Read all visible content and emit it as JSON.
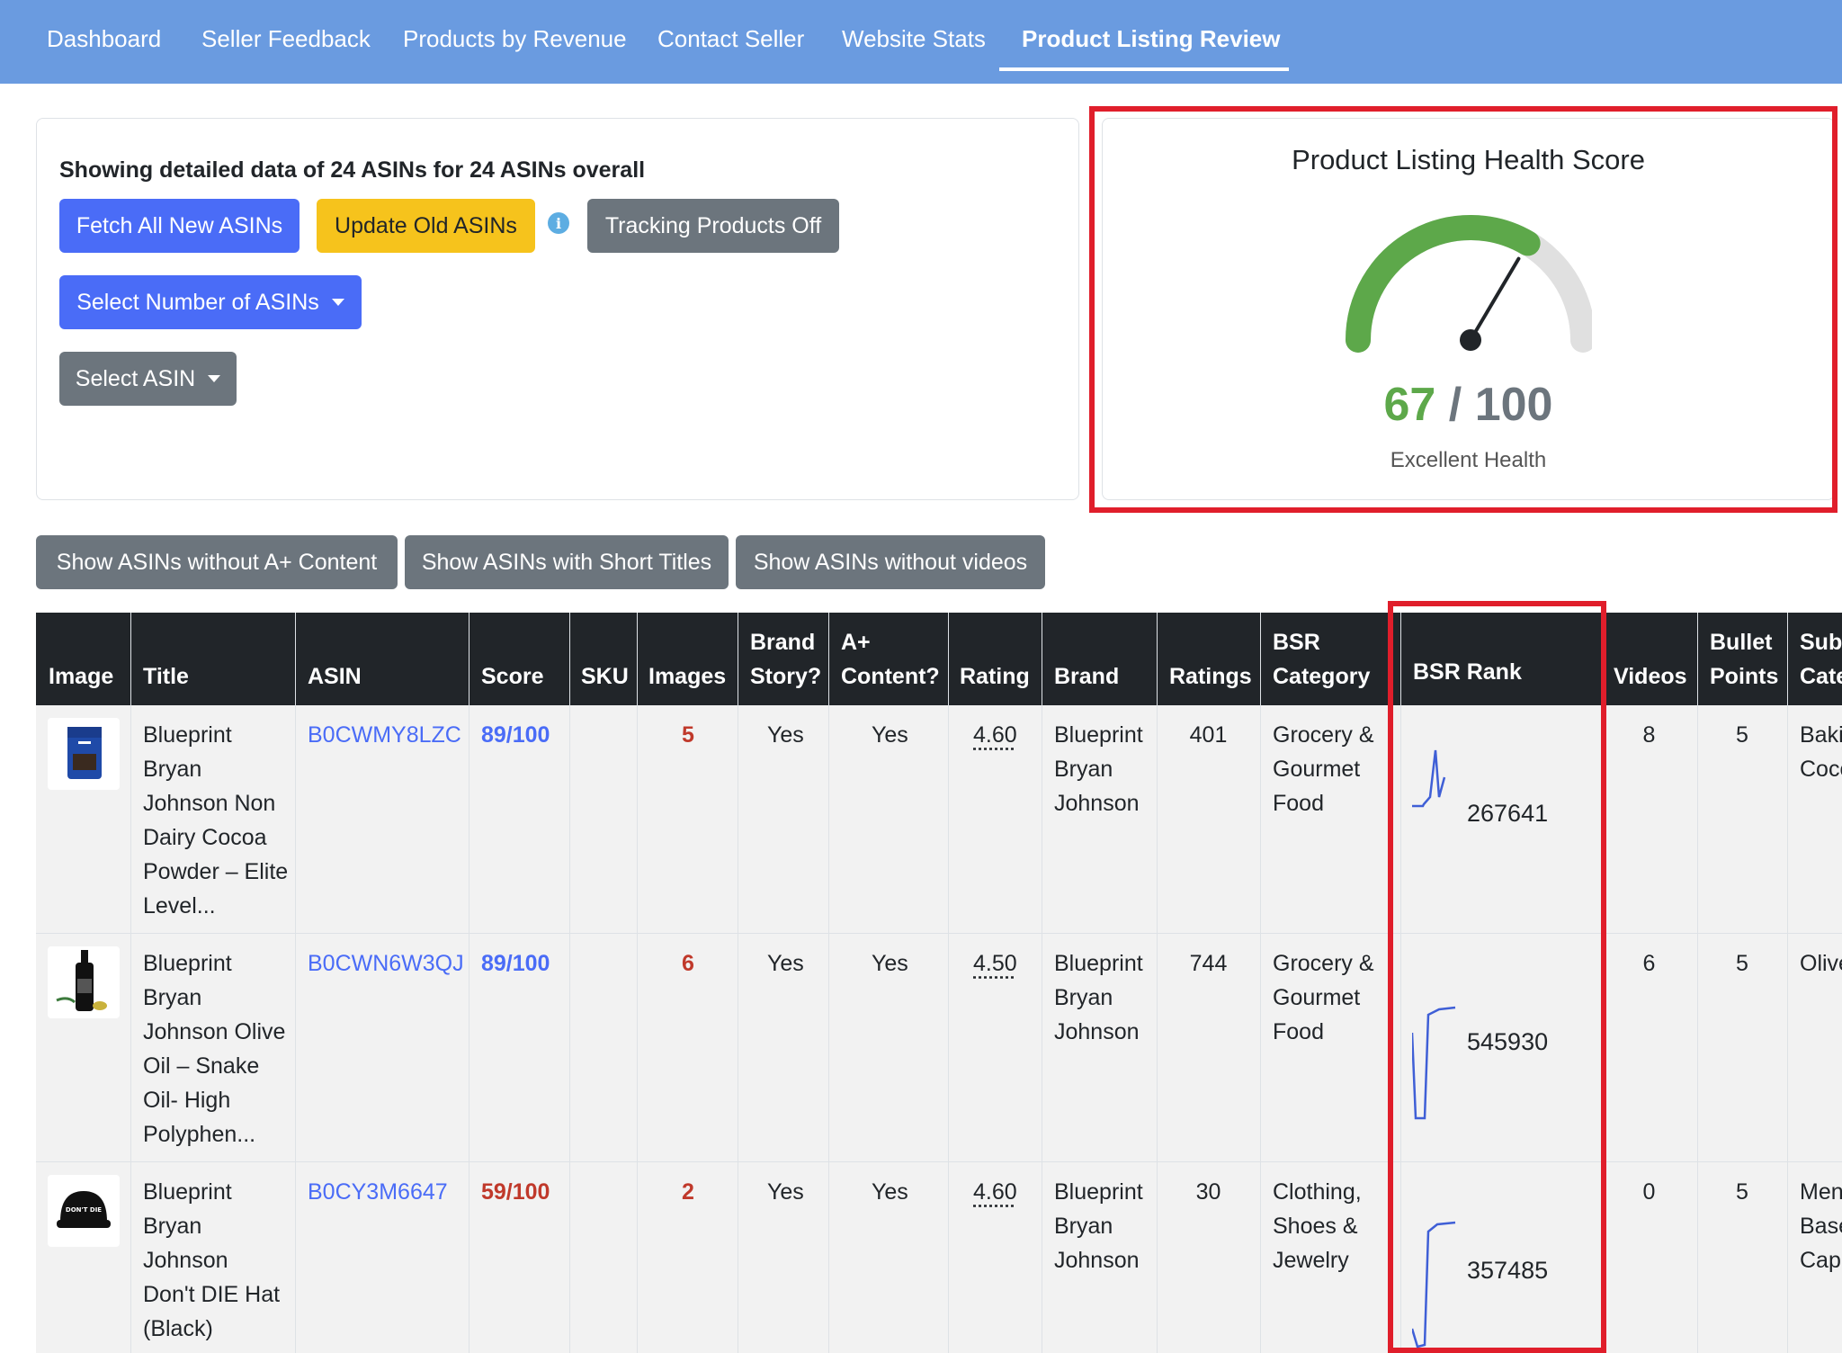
{
  "nav": {
    "items": [
      "Dashboard",
      "Seller Feedback",
      "Products by Revenue",
      "Contact Seller",
      "Website Stats",
      "Product Listing Review"
    ],
    "active": "Product Listing Review"
  },
  "controls": {
    "showing_text": "Showing detailed data of 24 ASINs for 24 ASINs overall",
    "fetch_label": "Fetch All New ASINs",
    "update_label": "Update Old ASINs",
    "info_glyph": "i",
    "tracking_label": "Tracking Products Off",
    "select_number_label": "Select Number of ASINs",
    "select_asin_label": "Select ASIN"
  },
  "health": {
    "title": "Product Listing Health Score",
    "score": "67",
    "separator": " / ",
    "max": "100",
    "score_fraction": 0.67,
    "label": "Excellent Health",
    "fill_color": "#5da84a",
    "track_color": "#e0e0e0"
  },
  "filters": {
    "no_aplus": "Show ASINs without A+ Content",
    "short_titles": "Show ASINs with Short Titles",
    "no_videos": "Show ASINs without videos"
  },
  "table": {
    "headers": {
      "image": "Image",
      "title": "Title",
      "asin": "ASIN",
      "score": "Score",
      "sku": "SKU",
      "images": "Images",
      "brand_story_1": "Brand",
      "brand_story_2": "Story?",
      "aplus_1": "A+",
      "aplus_2": "Content?",
      "rating": "Rating",
      "brand": "Brand",
      "ratings": "Ratings",
      "bsr_cat_1": "BSR",
      "bsr_cat_2": "Category",
      "bsr_rank": "BSR Rank",
      "videos": "Videos",
      "bullet_1": "Bullet",
      "bullet_2": "Points",
      "sub_1": "Sub",
      "sub_2": "Cate"
    },
    "rows": [
      {
        "title_lines": [
          "Blueprint",
          "Bryan",
          "Johnson Non",
          "Dairy Cocoa",
          "Powder – Elite",
          "Level..."
        ],
        "asin": "B0CWMY8LZC",
        "score": "89/100",
        "images": "5",
        "brand_story": "Yes",
        "aplus": "Yes",
        "rating": "4.60",
        "brand_lines": [
          "Blueprint",
          "Bryan",
          "Johnson"
        ],
        "ratings": "401",
        "category_lines": [
          "Grocery &",
          "Gourmet",
          "Food"
        ],
        "bsr_rank": "267641",
        "videos": "8",
        "bullets": "5",
        "sub_lines": [
          "Baki",
          "Coco"
        ],
        "thumb_icon": "cocoa-powder-bag-icon"
      },
      {
        "title_lines": [
          "Blueprint",
          "Bryan",
          "Johnson Olive",
          "Oil – Snake",
          "Oil- High",
          "Polyphen..."
        ],
        "asin": "B0CWN6W3QJ",
        "score": "89/100",
        "images": "6",
        "brand_story": "Yes",
        "aplus": "Yes",
        "rating": "4.50",
        "brand_lines": [
          "Blueprint",
          "Bryan",
          "Johnson"
        ],
        "ratings": "744",
        "category_lines": [
          "Grocery &",
          "Gourmet",
          "Food"
        ],
        "bsr_rank": "545930",
        "videos": "6",
        "bullets": "5",
        "sub_lines": [
          "Olive"
        ],
        "thumb_icon": "olive-oil-bottle-icon"
      },
      {
        "title_lines": [
          "Blueprint",
          "Bryan",
          "Johnson",
          "Don't DIE Hat",
          "(Black)"
        ],
        "asin": "B0CY3M6647",
        "score": "59/100",
        "images": "2",
        "brand_story": "Yes",
        "aplus": "Yes",
        "rating": "4.60",
        "brand_lines": [
          "Blueprint",
          "Bryan",
          "Johnson"
        ],
        "ratings": "30",
        "category_lines": [
          "Clothing,",
          "Shoes &",
          "Jewelry"
        ],
        "bsr_rank": "357485",
        "videos": "0",
        "bullets": "5",
        "sub_lines": [
          "Men",
          "Base",
          "Cap"
        ],
        "thumb_icon": "black-cap-icon",
        "thumb_text": "DON'T DIE"
      }
    ]
  },
  "colors": {
    "nav_bg": "#6a9be0",
    "primary": "#4a6cf7",
    "warning": "#f6c31c",
    "secondary": "#6c757d",
    "danger": "#c0392b",
    "highlight": "#e01e2b",
    "table_head": "#212529"
  }
}
